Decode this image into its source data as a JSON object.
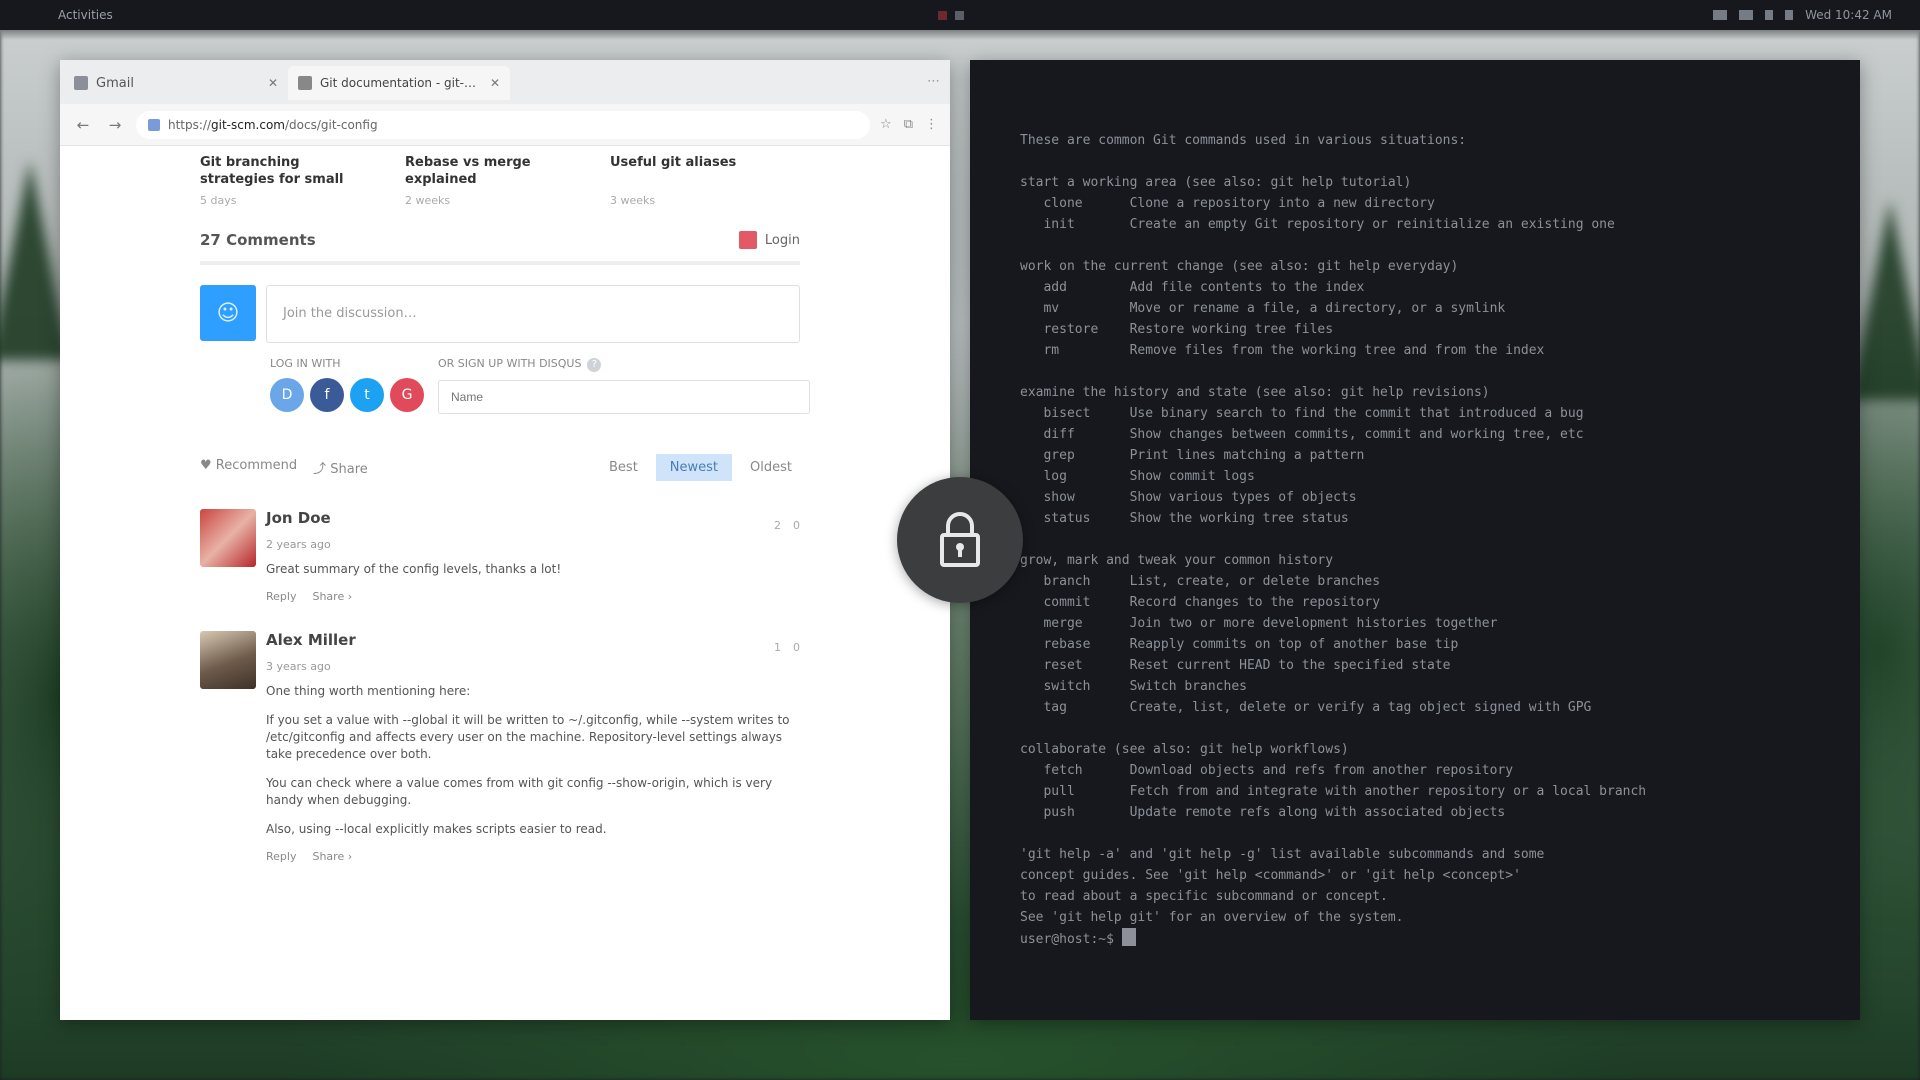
{
  "top_panel": {
    "activities": "Activities",
    "clock": "Wed 10:42 AM"
  },
  "browser": {
    "tabs": [
      {
        "title": "Gmail"
      },
      {
        "title": "Git documentation - git-config"
      }
    ],
    "url": {
      "protocol": "https://",
      "domain": "git-scm.com",
      "path": "/docs/git-config"
    },
    "related": [
      {
        "title": "Git branching strategies for small teams",
        "meta": "5 days"
      },
      {
        "title": "Rebase vs merge explained",
        "meta": "2 weeks"
      },
      {
        "title": "Useful git aliases",
        "meta": "3 weeks"
      }
    ],
    "comments": {
      "count_label": "27 Comments",
      "login_label": "Login",
      "composer_placeholder": "Join the discussion…",
      "login_with": "LOG IN WITH",
      "signup_label": "OR SIGN UP WITH DISQUS",
      "name_placeholder": "Name",
      "sort": {
        "recommend": "♥ Recommend",
        "share": "⤴ Share",
        "options": [
          "Best",
          "Newest",
          "Oldest"
        ],
        "active": "Newest"
      },
      "items": [
        {
          "author": "Jon Doe",
          "time": "2 years ago",
          "votes_up": "2",
          "votes_down": "0",
          "text": [
            "Great summary of the config levels, thanks a lot!"
          ],
          "actions": [
            "Reply",
            "Share ›"
          ]
        },
        {
          "author": "Alex Miller",
          "time": "3 years ago",
          "votes_up": "1",
          "votes_down": "0",
          "text": [
            "One thing worth mentioning here:",
            "If you set a value with --global it will be written to ~/.gitconfig, while --system writes to /etc/gitconfig and affects every user on the machine. Repository-level settings always take precedence over both.",
            "You can check where a value comes from with git config --show-origin, which is very handy when debugging.",
            "Also, using --local explicitly makes scripts easier to read."
          ],
          "actions": [
            "Reply",
            "Share ›"
          ]
        }
      ]
    }
  },
  "terminal": {
    "lines": [
      "These are common Git commands used in various situations:",
      "",
      "start a working area (see also: git help tutorial)",
      "   clone      Clone a repository into a new directory",
      "   init       Create an empty Git repository or reinitialize an existing one",
      "",
      "work on the current change (see also: git help everyday)",
      "   add        Add file contents to the index",
      "   mv         Move or rename a file, a directory, or a symlink",
      "   restore    Restore working tree files",
      "   rm         Remove files from the working tree and from the index",
      "",
      "examine the history and state (see also: git help revisions)",
      "   bisect     Use binary search to find the commit that introduced a bug",
      "   diff       Show changes between commits, commit and working tree, etc",
      "   grep       Print lines matching a pattern",
      "   log        Show commit logs",
      "   show       Show various types of objects",
      "   status     Show the working tree status",
      "",
      "grow, mark and tweak your common history",
      "   branch     List, create, or delete branches",
      "   commit     Record changes to the repository",
      "   merge      Join two or more development histories together",
      "   rebase     Reapply commits on top of another base tip",
      "   reset      Reset current HEAD to the specified state",
      "   switch     Switch branches",
      "   tag        Create, list, delete or verify a tag object signed with GPG",
      "",
      "collaborate (see also: git help workflows)",
      "   fetch      Download objects and refs from another repository",
      "   pull       Fetch from and integrate with another repository or a local branch",
      "   push       Update remote refs along with associated objects",
      "",
      "'git help -a' and 'git help -g' list available subcommands and some",
      "concept guides. See 'git help <command>' or 'git help <concept>'",
      "to read about a specific subcommand or concept.",
      "See 'git help git' for an overview of the system.",
      "user@host:~$ "
    ]
  }
}
